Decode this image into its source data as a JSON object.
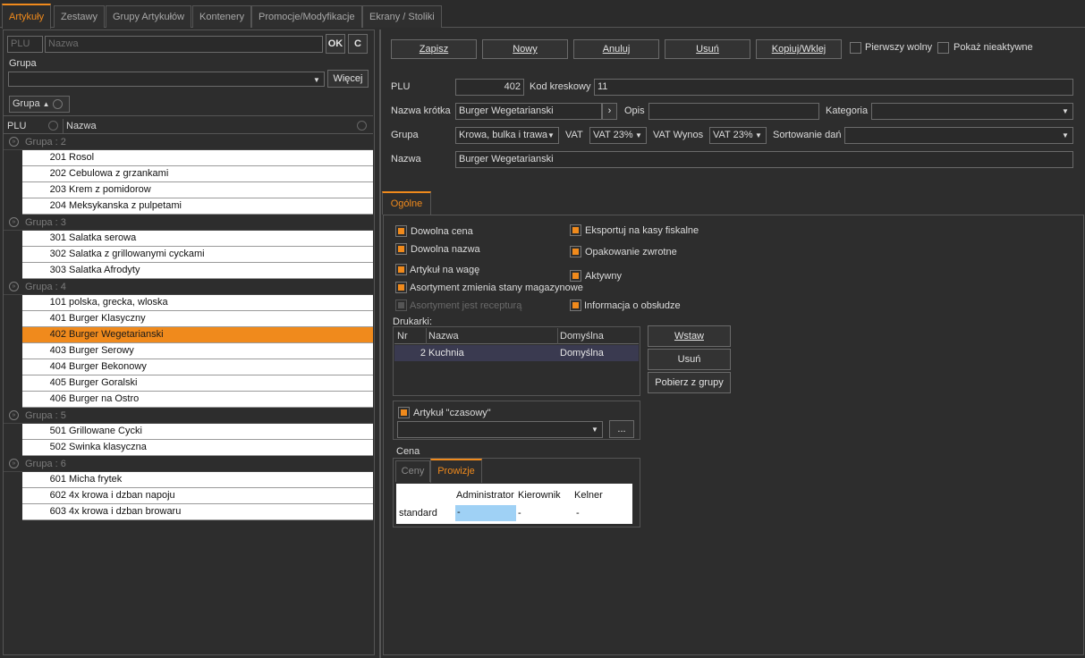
{
  "tabs": [
    "Artykuły",
    "Zestawy",
    "Grupy Artykułów",
    "Kontenery",
    "Promocje/Modyfikacje",
    "Ekrany / Stoliki"
  ],
  "left": {
    "plu_placeholder": "PLU",
    "name_placeholder": "Nazwa",
    "ok_label": "OK",
    "clear_label": "C",
    "group_label": "Grupa",
    "more_label": "Więcej",
    "groupby_chip": "Grupa",
    "col_plu": "PLU",
    "col_name": "Nazwa",
    "groups": [
      {
        "label": "Grupa : 2",
        "rows": [
          {
            "plu": "201",
            "name": "Rosol"
          },
          {
            "plu": "202",
            "name": "Cebulowa z grzankami"
          },
          {
            "plu": "203",
            "name": "Krem z pomidorow"
          },
          {
            "plu": "204",
            "name": "Meksykanska z pulpetami"
          }
        ]
      },
      {
        "label": "Grupa : 3",
        "rows": [
          {
            "plu": "301",
            "name": "Salatka serowa"
          },
          {
            "plu": "302",
            "name": "Salatka z grillowanymi cyckami"
          },
          {
            "plu": "303",
            "name": "Salatka Afrodyty"
          }
        ]
      },
      {
        "label": "Grupa : 4",
        "rows": [
          {
            "plu": "101",
            "name": "polska, grecka, wloska"
          },
          {
            "plu": "401",
            "name": "Burger Klasyczny"
          },
          {
            "plu": "402",
            "name": "Burger Wegetarianski",
            "selected": true
          },
          {
            "plu": "403",
            "name": "Burger Serowy"
          },
          {
            "plu": "404",
            "name": "Burger Bekonowy"
          },
          {
            "plu": "405",
            "name": "Burger Goralski"
          },
          {
            "plu": "406",
            "name": "Burger na Ostro"
          }
        ]
      },
      {
        "label": "Grupa : 5",
        "rows": [
          {
            "plu": "501",
            "name": "Grillowane Cycki"
          },
          {
            "plu": "502",
            "name": "Swinka klasyczna"
          }
        ]
      },
      {
        "label": "Grupa : 6",
        "rows": [
          {
            "plu": "601",
            "name": "Micha frytek"
          },
          {
            "plu": "602",
            "name": "4x krowa i dzban napoju"
          },
          {
            "plu": "603",
            "name": "4x krowa i dzban browaru"
          }
        ]
      }
    ]
  },
  "toolbar": {
    "save": "Zapisz",
    "new": "Nowy",
    "cancel": "Anuluj",
    "delete": "Usuń",
    "copy": "Kopiuj/Wklej",
    "first_free": "Pierwszy wolny",
    "show_inactive": "Pokaż nieaktywne"
  },
  "form": {
    "plu_label": "PLU",
    "plu_value": "402",
    "barcode_label": "Kod kreskowy",
    "barcode_value": "11",
    "short_name_label": "Nazwa krótka",
    "short_name_value": "Burger Wegetarianski",
    "opis_label": "Opis",
    "opis_value": "",
    "category_label": "Kategoria",
    "category_value": "",
    "group_label": "Grupa",
    "group_value": "Krowa, bulka i trawa",
    "vat_label": "VAT",
    "vat_value": "VAT 23%",
    "vat_out_label": "VAT Wynos",
    "vat_out_value": "VAT 23%",
    "sort_label": "Sortowanie dań",
    "sort_value": "",
    "name_label": "Nazwa",
    "name_value": "Burger Wegetarianski"
  },
  "subtab": "Ogólne",
  "options": {
    "free_price": "Dowolna cena",
    "free_name": "Dowolna nazwa",
    "weighted": "Artykuł na wagę",
    "assortment_stock": "Asortyment zmienia stany magazynowe",
    "assortment_recipe": "Asortyment jest recepturą",
    "export_fiscal": "Eksportuj na kasy fiskalne",
    "return_pack": "Opakowanie zwrotne",
    "active": "Aktywny",
    "staff_info": "Informacja o obsłudze"
  },
  "printers": {
    "label": "Drukarki:",
    "headers": [
      "Nr",
      "Nazwa",
      "Domyślna"
    ],
    "rows": [
      {
        "nr": "2",
        "name": "Kuchnia",
        "default": "Domyślna"
      }
    ],
    "insert": "Wstaw",
    "remove": "Usuń",
    "from_group": "Pobierz z grupy"
  },
  "timed": {
    "label": "Artykuł \"czasowy\"",
    "value": "",
    "more": "..."
  },
  "price": {
    "label": "Cena",
    "tab_prices": "Ceny",
    "tab_commission": "Prowizje",
    "headers": [
      "Administrator",
      "Kierownik",
      "Kelner"
    ],
    "row_label": "standard",
    "values": [
      "-",
      "-",
      "-"
    ]
  },
  "colors": {
    "accent": "#f08a1c",
    "bg": "#2d2d2d",
    "selection_cell": "#9fd1f5"
  }
}
